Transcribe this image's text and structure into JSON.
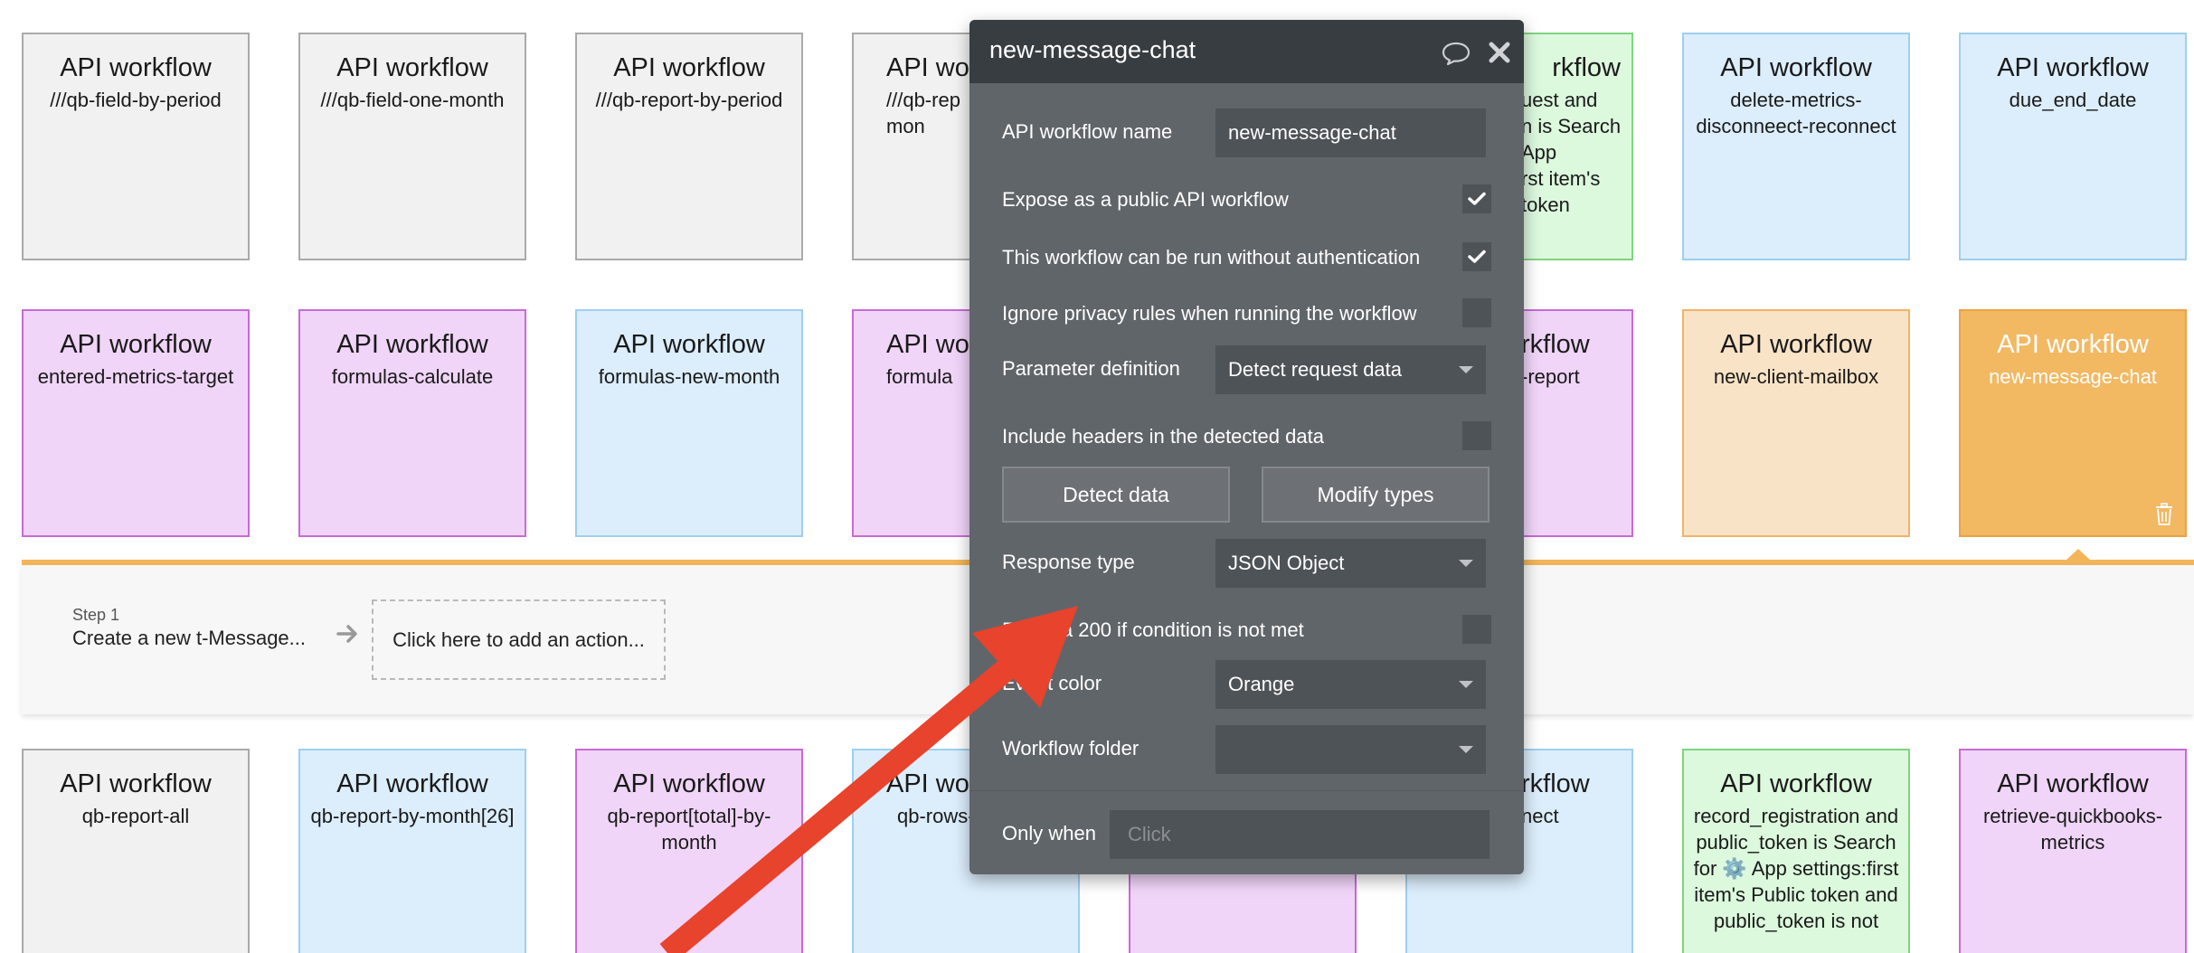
{
  "cards_row1": [
    {
      "title": "API workflow",
      "name": "///qb-field-by-period"
    },
    {
      "title": "API workflow",
      "name": "///qb-field-one-month"
    },
    {
      "title": "API workflow",
      "name": "///qb-report-by-period"
    },
    {
      "title": "API wo",
      "name": "///qb-rep\nmon"
    },
    {
      "title": "rkflow",
      "name": "uest and\nn is Search\nApp\nrst item's\ntoken"
    },
    {
      "title": "API workflow",
      "name": "delete-metrics-disconneect-reconnect"
    },
    {
      "title": "API workflow",
      "name": "due_end_date"
    }
  ],
  "cards_row2": [
    {
      "title": "API workflow",
      "name": "entered-metrics-target"
    },
    {
      "title": "API workflow",
      "name": "formulas-calculate"
    },
    {
      "title": "API workflow",
      "name": "formulas-new-month"
    },
    {
      "title": "API wo",
      "name": "formula"
    },
    {
      "title": "rkflow",
      "name": "-report"
    },
    {
      "title": "API workflow",
      "name": "new-client-mailbox"
    },
    {
      "title": "API workflow",
      "name": "new-message-chat"
    }
  ],
  "cards_row3": [
    {
      "title": "API workflow",
      "name": "qb-report-all"
    },
    {
      "title": "API workflow",
      "name": "qb-report-by-month[26]"
    },
    {
      "title": "API workflow",
      "name": "qb-report[total]-by-month"
    },
    {
      "title": "API wo",
      "name": "qb-rows-by-"
    },
    {
      "title": "",
      "name": ""
    },
    {
      "title": "rkflow",
      "name": "nect"
    },
    {
      "title": "API workflow",
      "name": "record_registration and public_token is Search for ⚙️ App settings:first item's Public token and public_token is not"
    },
    {
      "title": "API workflow",
      "name": "retrieve-quickbooks-metrics"
    }
  ],
  "workflow": {
    "step_label": "Step 1",
    "step_name": "Create a new t-Message...",
    "add_action": "Click here to add an action..."
  },
  "editor": {
    "title": "new-message-chat",
    "name_label": "API workflow name",
    "name_value": "new-message-chat",
    "expose_label": "Expose as a public API workflow",
    "expose_checked": true,
    "noauth_label": "This workflow can be run without authentication",
    "noauth_checked": true,
    "privacy_label": "Ignore privacy rules when running the workflow",
    "privacy_checked": false,
    "param_label": "Parameter definition",
    "param_value": "Detect request data",
    "headers_label": "Include headers in the detected data",
    "headers_checked": false,
    "detect_button": "Detect data",
    "modify_button": "Modify types",
    "response_label": "Response type",
    "response_value": "JSON Object",
    "return200_label_prefix": "R",
    "return200_label_suffix": "a 200 if condition is not met",
    "return200_checked": false,
    "color_label": "Event color",
    "color_value": "Orange",
    "folder_label": "Workflow folder",
    "folder_value": "",
    "only_when_label": "Only when",
    "only_when_placeholder": "Click"
  },
  "colors": {
    "annotation_arrow": "#e8432c",
    "selected_card": "#f2b862",
    "editor_bg": "#60656a",
    "editor_header": "#383d41"
  }
}
